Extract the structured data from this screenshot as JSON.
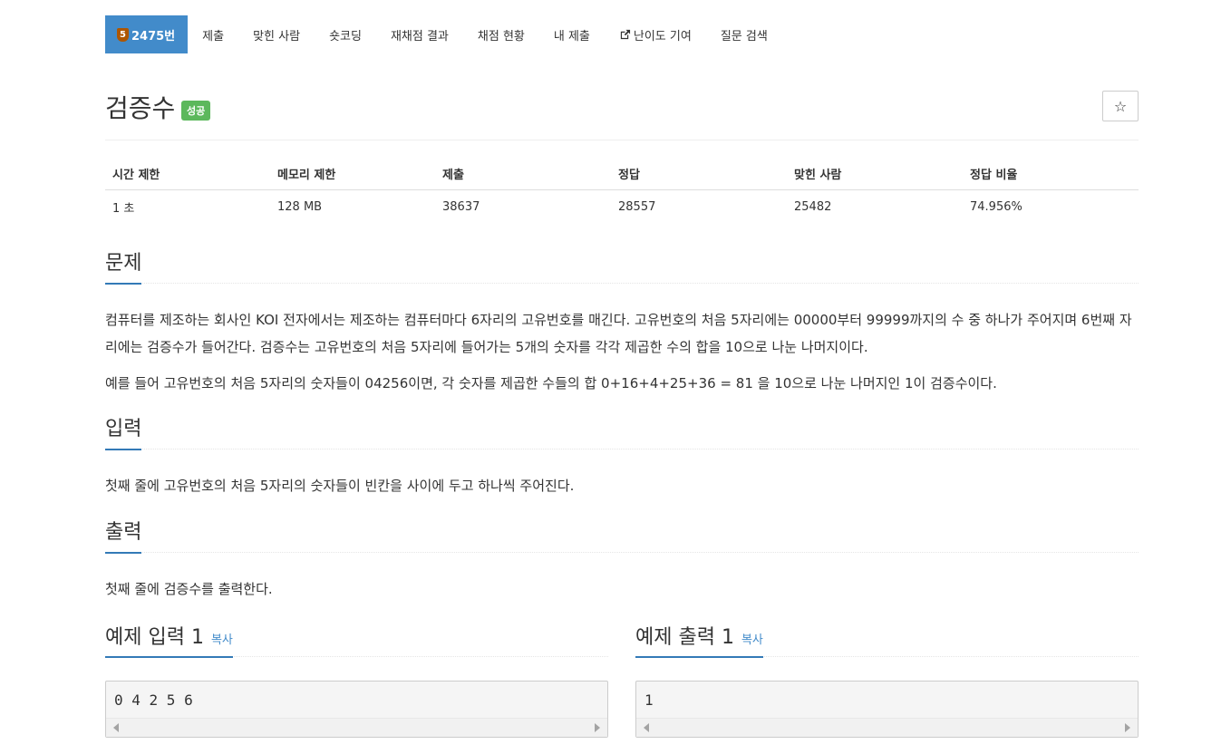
{
  "nav": {
    "tier_badge": "5",
    "problem_number": "2475번",
    "items": [
      "제출",
      "맞힌 사람",
      "숏코딩",
      "재채점 결과",
      "채점 현황",
      "내 제출",
      "난이도 기여",
      "질문 검색"
    ]
  },
  "title": "검증수",
  "result_label": "성공",
  "star_icon": "☆",
  "info": {
    "headers": [
      "시간 제한",
      "메모리 제한",
      "제출",
      "정답",
      "맞힌 사람",
      "정답 비율"
    ],
    "values": [
      "1 초",
      "128 MB",
      "38637",
      "28557",
      "25482",
      "74.956%"
    ]
  },
  "sections": {
    "problem": {
      "heading": "문제",
      "paragraphs": [
        "컴퓨터를 제조하는 회사인 KOI 전자에서는 제조하는 컴퓨터마다 6자리의 고유번호를 매긴다. 고유번호의 처음 5자리에는 00000부터 99999까지의 수 중 하나가 주어지며 6번째 자리에는 검증수가 들어간다. 검증수는 고유번호의 처음 5자리에 들어가는 5개의 숫자를 각각 제곱한 수의 합을 10으로 나눈 나머지이다.",
        "예를 들어 고유번호의 처음 5자리의 숫자들이 04256이면, 각 숫자를 제곱한 수들의 합 0+16+4+25+36 = 81 을 10으로 나눈 나머지인 1이 검증수이다."
      ]
    },
    "input": {
      "heading": "입력",
      "text": "첫째 줄에 고유번호의 처음 5자리의 숫자들이 빈칸을 사이에 두고 하나씩 주어진다."
    },
    "output": {
      "heading": "출력",
      "text": "첫째 줄에 검증수를 출력한다."
    }
  },
  "samples": {
    "input": {
      "heading": "예제 입력 1",
      "copy_label": "복사",
      "content": "0 4 2 5 6"
    },
    "output": {
      "heading": "예제 출력 1",
      "copy_label": "복사",
      "content": "1"
    }
  },
  "colors": {
    "accent": "#428bca",
    "success": "#5cb85c",
    "tier_bronze": "#ad5600"
  }
}
